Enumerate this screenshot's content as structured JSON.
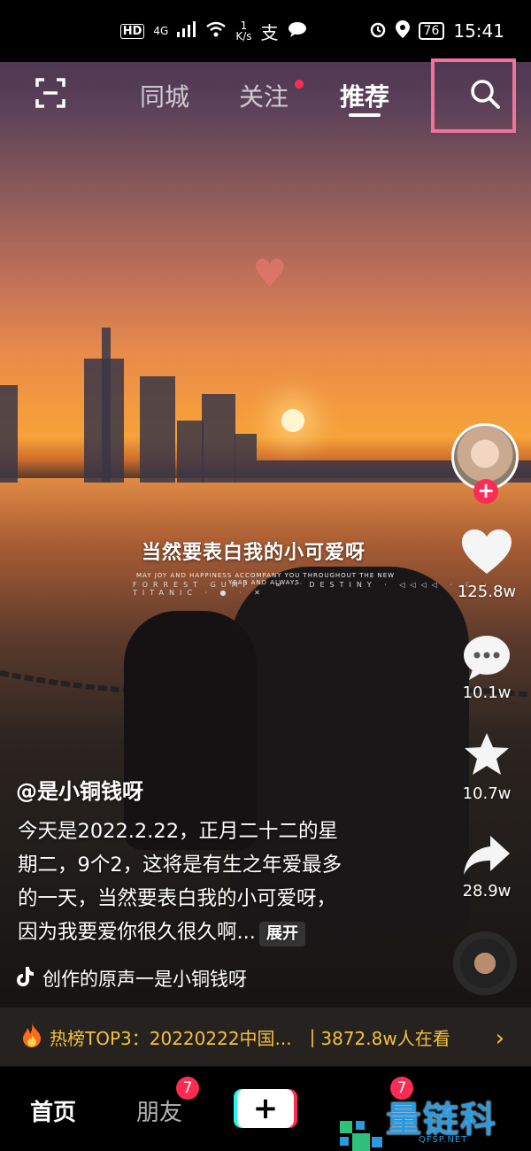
{
  "status_bar": {
    "hd": "HD",
    "network": "4G",
    "speed_value": "1",
    "speed_unit": "K/s",
    "battery": "76",
    "time": "15:41"
  },
  "top_nav": {
    "tabs": [
      {
        "label": "同城",
        "active": false
      },
      {
        "label": "关注",
        "active": false,
        "has_dot": true
      },
      {
        "label": "推荐",
        "active": true
      }
    ],
    "scan_icon": "scan-icon",
    "search_icon": "search-icon",
    "highlight_color": "#f07399"
  },
  "video": {
    "overlay_title": "当然要表白我的小可爱呀",
    "overlay_sub": "MAY JOY AND HAPPINESS ACCOMPANY YOU THROUGHOUT THE NEW YEAR AND ALWAYS.",
    "overlay_logos": "FORREST GUMP · ∞ · DESTINY · ◁◁◁◁ · ☾ · TITANIC · ● · ✕"
  },
  "actions": {
    "likes": "125.8w",
    "comments": "10.1w",
    "favorites": "10.7w",
    "shares": "28.9w"
  },
  "post": {
    "author": "@是小铜钱呀",
    "caption_lines": [
      "今天是2022.2.22，正月二十二的星",
      "期二，9个2，这将是有生之年爱最多",
      "的一天，当然要表白我的小可爱呀，",
      "因为我要爱你很久很久啊..."
    ],
    "expand_label": "展开",
    "music": "创作的原声一是小铜钱呀"
  },
  "hot_bar": {
    "title": "热榜TOP3：20220222中国...",
    "separator": "|",
    "views": "3872.8w人在看"
  },
  "bottom_nav": {
    "home": "首页",
    "friends": "朋友",
    "friends_badge": "7",
    "messages_badge": "7",
    "plus": "+"
  },
  "watermark": {
    "text": "量链科技",
    "sub": "QFSP.NET"
  },
  "colors": {
    "accent": "#fe2c55",
    "hot": "#f5c13a",
    "watermark": "#2a9be0"
  }
}
